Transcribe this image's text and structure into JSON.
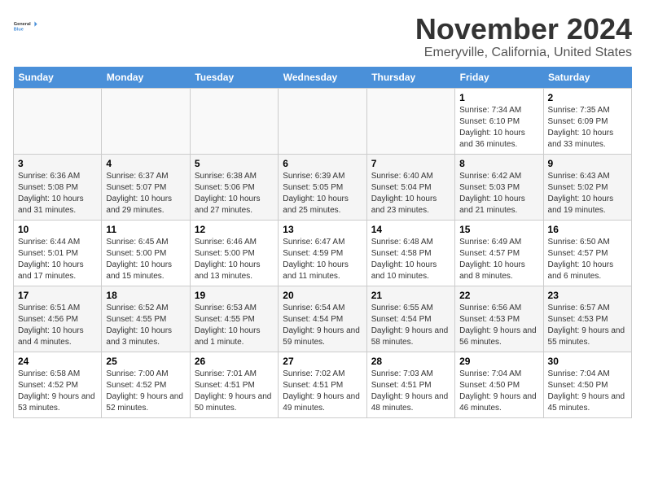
{
  "logo": {
    "line1": "General",
    "line2": "Blue"
  },
  "title": "November 2024",
  "location": "Emeryville, California, United States",
  "days_header": [
    "Sunday",
    "Monday",
    "Tuesday",
    "Wednesday",
    "Thursday",
    "Friday",
    "Saturday"
  ],
  "weeks": [
    [
      {
        "day": "",
        "info": ""
      },
      {
        "day": "",
        "info": ""
      },
      {
        "day": "",
        "info": ""
      },
      {
        "day": "",
        "info": ""
      },
      {
        "day": "",
        "info": ""
      },
      {
        "day": "1",
        "info": "Sunrise: 7:34 AM\nSunset: 6:10 PM\nDaylight: 10 hours and 36 minutes."
      },
      {
        "day": "2",
        "info": "Sunrise: 7:35 AM\nSunset: 6:09 PM\nDaylight: 10 hours and 33 minutes."
      }
    ],
    [
      {
        "day": "3",
        "info": "Sunrise: 6:36 AM\nSunset: 5:08 PM\nDaylight: 10 hours and 31 minutes."
      },
      {
        "day": "4",
        "info": "Sunrise: 6:37 AM\nSunset: 5:07 PM\nDaylight: 10 hours and 29 minutes."
      },
      {
        "day": "5",
        "info": "Sunrise: 6:38 AM\nSunset: 5:06 PM\nDaylight: 10 hours and 27 minutes."
      },
      {
        "day": "6",
        "info": "Sunrise: 6:39 AM\nSunset: 5:05 PM\nDaylight: 10 hours and 25 minutes."
      },
      {
        "day": "7",
        "info": "Sunrise: 6:40 AM\nSunset: 5:04 PM\nDaylight: 10 hours and 23 minutes."
      },
      {
        "day": "8",
        "info": "Sunrise: 6:42 AM\nSunset: 5:03 PM\nDaylight: 10 hours and 21 minutes."
      },
      {
        "day": "9",
        "info": "Sunrise: 6:43 AM\nSunset: 5:02 PM\nDaylight: 10 hours and 19 minutes."
      }
    ],
    [
      {
        "day": "10",
        "info": "Sunrise: 6:44 AM\nSunset: 5:01 PM\nDaylight: 10 hours and 17 minutes."
      },
      {
        "day": "11",
        "info": "Sunrise: 6:45 AM\nSunset: 5:00 PM\nDaylight: 10 hours and 15 minutes."
      },
      {
        "day": "12",
        "info": "Sunrise: 6:46 AM\nSunset: 5:00 PM\nDaylight: 10 hours and 13 minutes."
      },
      {
        "day": "13",
        "info": "Sunrise: 6:47 AM\nSunset: 4:59 PM\nDaylight: 10 hours and 11 minutes."
      },
      {
        "day": "14",
        "info": "Sunrise: 6:48 AM\nSunset: 4:58 PM\nDaylight: 10 hours and 10 minutes."
      },
      {
        "day": "15",
        "info": "Sunrise: 6:49 AM\nSunset: 4:57 PM\nDaylight: 10 hours and 8 minutes."
      },
      {
        "day": "16",
        "info": "Sunrise: 6:50 AM\nSunset: 4:57 PM\nDaylight: 10 hours and 6 minutes."
      }
    ],
    [
      {
        "day": "17",
        "info": "Sunrise: 6:51 AM\nSunset: 4:56 PM\nDaylight: 10 hours and 4 minutes."
      },
      {
        "day": "18",
        "info": "Sunrise: 6:52 AM\nSunset: 4:55 PM\nDaylight: 10 hours and 3 minutes."
      },
      {
        "day": "19",
        "info": "Sunrise: 6:53 AM\nSunset: 4:55 PM\nDaylight: 10 hours and 1 minute."
      },
      {
        "day": "20",
        "info": "Sunrise: 6:54 AM\nSunset: 4:54 PM\nDaylight: 9 hours and 59 minutes."
      },
      {
        "day": "21",
        "info": "Sunrise: 6:55 AM\nSunset: 4:54 PM\nDaylight: 9 hours and 58 minutes."
      },
      {
        "day": "22",
        "info": "Sunrise: 6:56 AM\nSunset: 4:53 PM\nDaylight: 9 hours and 56 minutes."
      },
      {
        "day": "23",
        "info": "Sunrise: 6:57 AM\nSunset: 4:53 PM\nDaylight: 9 hours and 55 minutes."
      }
    ],
    [
      {
        "day": "24",
        "info": "Sunrise: 6:58 AM\nSunset: 4:52 PM\nDaylight: 9 hours and 53 minutes."
      },
      {
        "day": "25",
        "info": "Sunrise: 7:00 AM\nSunset: 4:52 PM\nDaylight: 9 hours and 52 minutes."
      },
      {
        "day": "26",
        "info": "Sunrise: 7:01 AM\nSunset: 4:51 PM\nDaylight: 9 hours and 50 minutes."
      },
      {
        "day": "27",
        "info": "Sunrise: 7:02 AM\nSunset: 4:51 PM\nDaylight: 9 hours and 49 minutes."
      },
      {
        "day": "28",
        "info": "Sunrise: 7:03 AM\nSunset: 4:51 PM\nDaylight: 9 hours and 48 minutes."
      },
      {
        "day": "29",
        "info": "Sunrise: 7:04 AM\nSunset: 4:50 PM\nDaylight: 9 hours and 46 minutes."
      },
      {
        "day": "30",
        "info": "Sunrise: 7:04 AM\nSunset: 4:50 PM\nDaylight: 9 hours and 45 minutes."
      }
    ]
  ]
}
